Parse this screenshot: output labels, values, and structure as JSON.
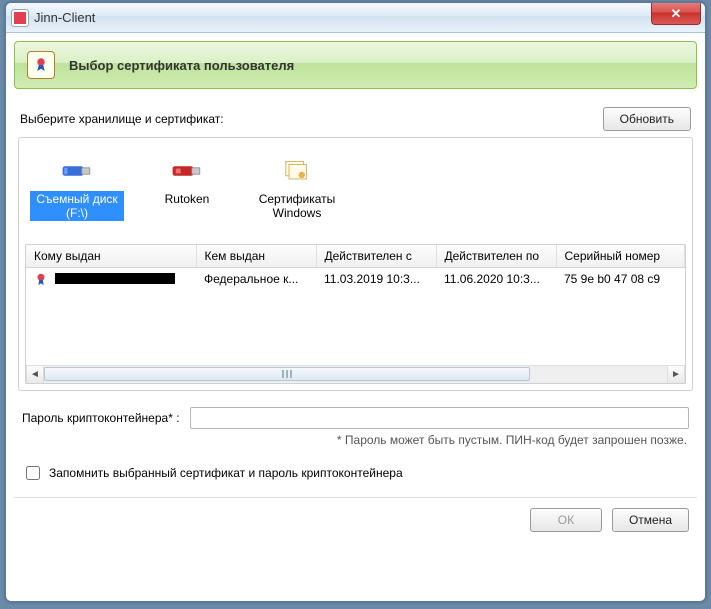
{
  "window": {
    "title": "Jinn-Client",
    "close_glyph": "✕"
  },
  "header": {
    "title": "Выбор сертификата пользователя"
  },
  "instruction": "Выберите хранилище и сертификат:",
  "buttons": {
    "refresh": "Обновить",
    "ok": "ОК",
    "cancel": "Отмена"
  },
  "storages": [
    {
      "id": "removable",
      "label": "Съемный диск (F:\\)",
      "selected": true
    },
    {
      "id": "rutoken",
      "label": "Rutoken",
      "selected": false
    },
    {
      "id": "wincerts",
      "label": "Сертификаты Windows",
      "selected": false
    }
  ],
  "cert_table": {
    "columns": [
      "Кому выдан",
      "Кем выдан",
      "Действителен с",
      "Действителен по",
      "Серийный номер"
    ],
    "rows": [
      {
        "issued_to_redacted": true,
        "issued_by": "Федеральное к...",
        "valid_from": "11.03.2019 10:3...",
        "valid_to": "11.06.2020 10:3...",
        "serial": "75 9e b0 47 08 c9"
      }
    ]
  },
  "password": {
    "label": "Пароль криптоконтейнера* :",
    "value": "",
    "hint": "* Пароль может быть пустым. ПИН-код будет запрошен позже."
  },
  "remember": {
    "label": "Запомнить выбранный сертификат и пароль криптоконтейнера",
    "checked": false
  },
  "scroll": {
    "left_glyph": "◄",
    "right_glyph": "►"
  }
}
